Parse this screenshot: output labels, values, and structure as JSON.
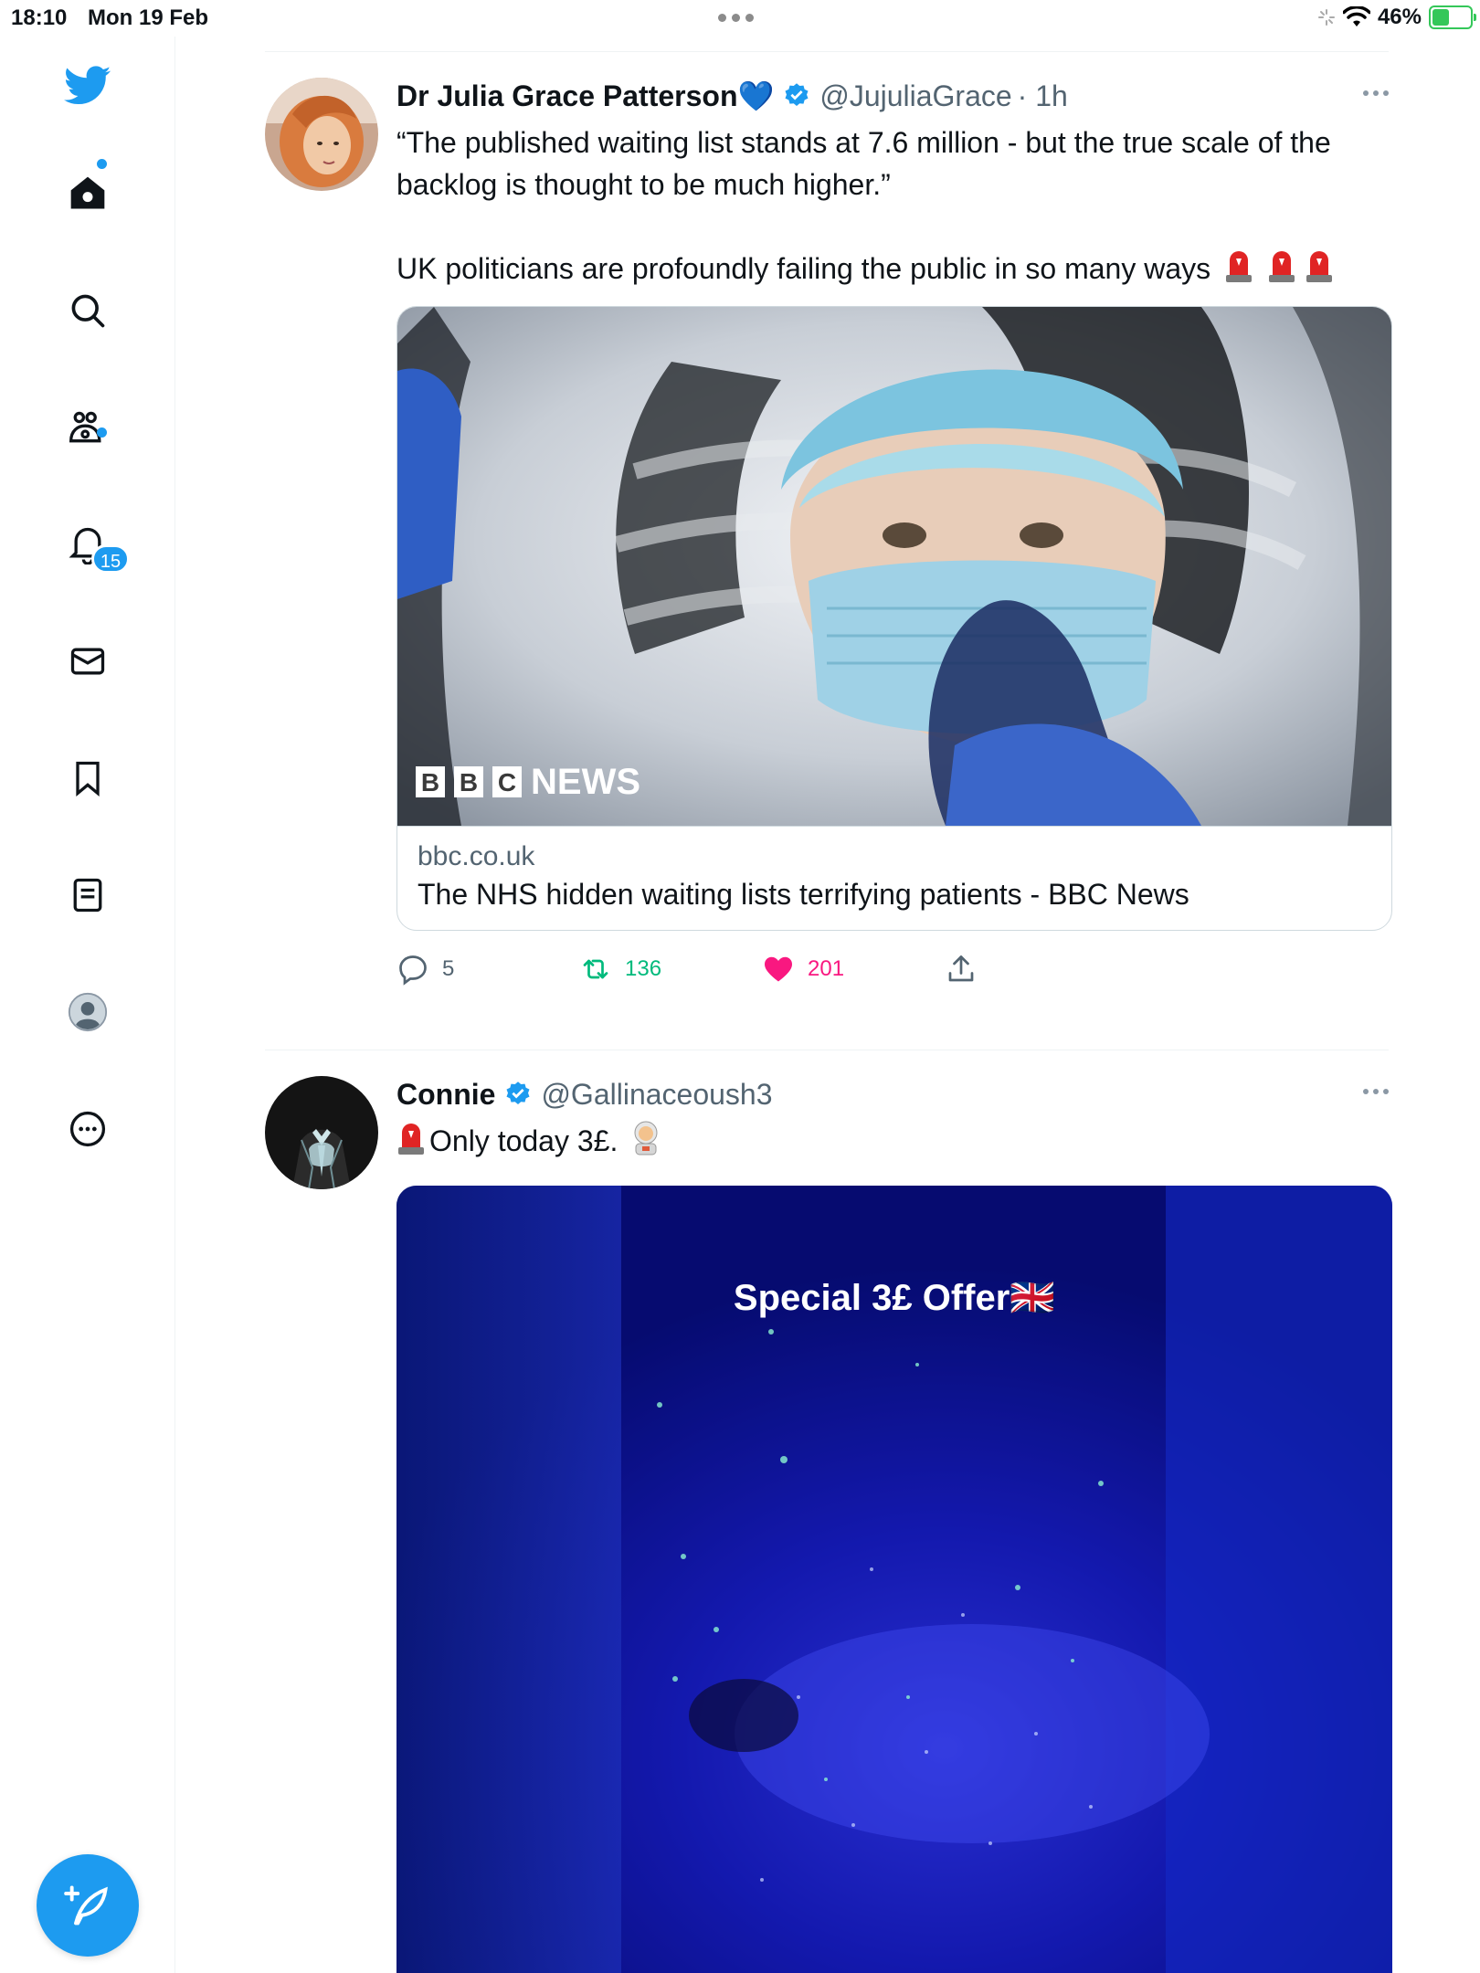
{
  "status_bar": {
    "time": "18:10",
    "date": "Mon 19 Feb",
    "battery": "46%"
  },
  "sidebar": {
    "items": [
      {
        "name": "home",
        "icon": "home-icon",
        "has_dot": true
      },
      {
        "name": "search",
        "icon": "search-icon"
      },
      {
        "name": "communities",
        "icon": "communities-icon",
        "has_dot": true
      },
      {
        "name": "notifications",
        "icon": "bell-icon",
        "badge": "15"
      },
      {
        "name": "messages",
        "icon": "mail-icon"
      },
      {
        "name": "bookmarks",
        "icon": "bookmark-icon"
      },
      {
        "name": "lists",
        "icon": "list-icon"
      },
      {
        "name": "profile",
        "icon": "avatar-icon"
      },
      {
        "name": "more",
        "icon": "more-circle-icon"
      }
    ],
    "compose_icon": "feather-plus-icon"
  },
  "colors": {
    "accent": "#1d9bf0",
    "like": "#f91880",
    "retweet": "#00ba7c",
    "text": "#0f1419",
    "secondary": "#536471"
  },
  "tweets": [
    {
      "name": "Dr Julia Grace Patterson",
      "name_emoji": "💙",
      "handle": "@JujuliaGrace",
      "time": "· 1h",
      "text_1": "“The published waiting list stands at 7.6 million - but the true scale of the backlog is thought to be much higher.”",
      "text_2": "UK politicians are profoundly failing the public in so many ways",
      "card": {
        "logo_text": "NEWS",
        "logo_letters": [
          "B",
          "B",
          "C"
        ],
        "domain": "bbc.co.uk",
        "title": "The NHS hidden waiting lists terrifying patients - BBC News"
      },
      "actions": {
        "replies": "5",
        "retweets": "136",
        "likes": "201"
      }
    },
    {
      "name": "Connie",
      "handle": "@Gallinaceoush3",
      "text": "Only today 3£.",
      "media_caption": "Special 3£ Offer🇬🇧"
    }
  ]
}
